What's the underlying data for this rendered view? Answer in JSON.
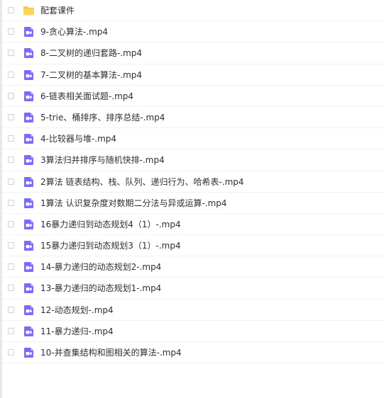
{
  "file_list": {
    "items": [
      {
        "name": "配套课件",
        "type": "folder",
        "icon": "folder-icon"
      },
      {
        "name": "9-贪心算法-.mp4",
        "type": "video",
        "icon": "video-file-icon"
      },
      {
        "name": "8-二叉树的递归套路-.mp4",
        "type": "video",
        "icon": "video-file-icon"
      },
      {
        "name": "7-二叉树的基本算法-.mp4",
        "type": "video",
        "icon": "video-file-icon"
      },
      {
        "name": "6-链表相关面试题-.mp4",
        "type": "video",
        "icon": "video-file-icon"
      },
      {
        "name": "5-trie、桶排序、排序总结-.mp4",
        "type": "video",
        "icon": "video-file-icon"
      },
      {
        "name": "4-比较器与堆-.mp4",
        "type": "video",
        "icon": "video-file-icon"
      },
      {
        "name": "3算法归并排序与随机快排-.mp4",
        "type": "video",
        "icon": "video-file-icon"
      },
      {
        "name": "2算法 链表结构、栈、队列、递归行为、哈希表-.mp4",
        "type": "video",
        "icon": "video-file-icon"
      },
      {
        "name": "1算法 认识复杂度对数期二分法与异或运算-.mp4",
        "type": "video",
        "icon": "video-file-icon"
      },
      {
        "name": "16暴力递归到动态规划4（1）-.mp4",
        "type": "video",
        "icon": "video-file-icon"
      },
      {
        "name": "15暴力递归到动态规划3（1）-.mp4",
        "type": "video",
        "icon": "video-file-icon"
      },
      {
        "name": "14-暴力递归的动态规划2-.mp4",
        "type": "video",
        "icon": "video-file-icon"
      },
      {
        "name": "13-暴力递归的动态规划1-.mp4",
        "type": "video",
        "icon": "video-file-icon"
      },
      {
        "name": "12-动态规划-.mp4",
        "type": "video",
        "icon": "video-file-icon"
      },
      {
        "name": "11-暴力递归-.mp4",
        "type": "video",
        "icon": "video-file-icon"
      },
      {
        "name": "10-并查集结构和图相关的算法-.mp4",
        "type": "video",
        "icon": "video-file-icon"
      }
    ]
  },
  "colors": {
    "folder": "#f7c940",
    "video": "#7b6cf6",
    "text": "#2b2f36",
    "divider": "#f1f2f4",
    "checkbox_border": "#cfd3d9"
  }
}
